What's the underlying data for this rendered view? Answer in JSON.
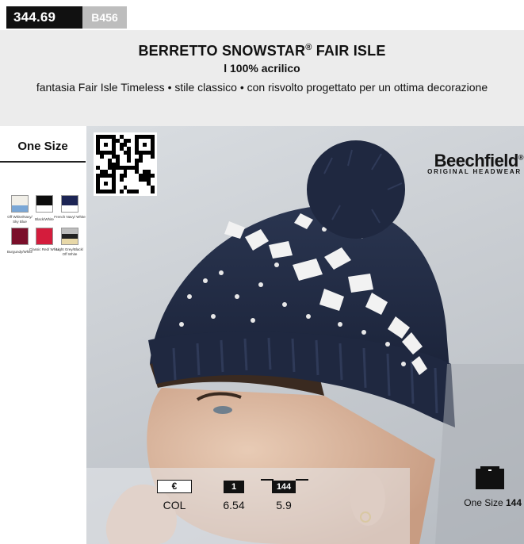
{
  "product": {
    "price_code": "344.69",
    "sku": "B456",
    "title_main": "BERRETTO SNOWSTAR",
    "title_reg": "®",
    "title_end": " FAIR ISLE",
    "material": "l 100% acrilico",
    "description": "fantasia Fair Isle Timeless  • stile classico • con risvolto progettato per un ottima decorazione"
  },
  "sizes": {
    "label": "One Size"
  },
  "swatches": [
    {
      "label": "Off White/Navy/ Sky Blue",
      "top": "#f1efe8",
      "bottom": "#7aa7d6"
    },
    {
      "label": "Black/White",
      "top": "#0d0d0d",
      "bottom": "#ffffff"
    },
    {
      "label": "French Navy/ White",
      "top": "#1c2454",
      "bottom": "#ffffff"
    },
    {
      "label": "Burgundy/White",
      "top": "#7a0f2a",
      "bottom": "#7a0f2a"
    },
    {
      "label": "Classic Red/ White",
      "top": "#d41c3c",
      "bottom": "#d41c3c"
    },
    {
      "label": "Light Grey/Black/ Off White",
      "top": "#222222",
      "bottom": "#e8d8a8"
    }
  ],
  "brand": {
    "name": "Beechfield",
    "reg": "®",
    "tagline": "ORIGINAL HEADWEAR"
  },
  "pricing": {
    "currency_symbol": "€",
    "col_label": "COL",
    "qty1": "1",
    "price1": "6.54",
    "qty2": "144",
    "price2": "5.9"
  },
  "packaging": {
    "label": "One Size",
    "qty": "144"
  },
  "icons": {
    "qr": "qr-code-icon",
    "box": "box-icon"
  }
}
